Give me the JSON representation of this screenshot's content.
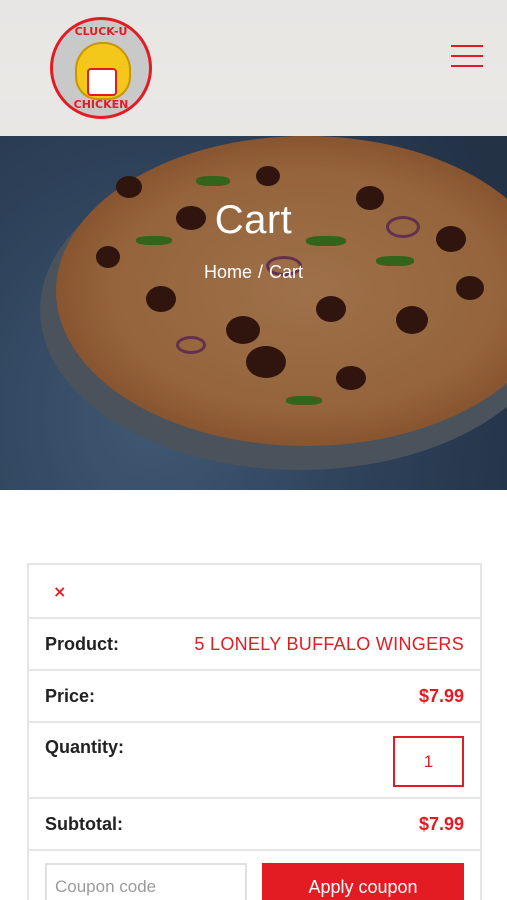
{
  "brand": {
    "logo_top_text": "CLUCK-U",
    "logo_bottom_text": "CHICKEN",
    "accent_color": "#e31b23"
  },
  "header": {
    "menu_icon": "hamburger-menu-icon"
  },
  "hero": {
    "title": "Cart",
    "breadcrumb": {
      "home": "Home",
      "separator": "/",
      "current": "Cart"
    }
  },
  "cart": {
    "remove_symbol": "×",
    "product_label": "Product:",
    "product_name": "5 LONELY BUFFALO WINGERS",
    "price_label": "Price:",
    "price_value": "$7.99",
    "quantity_label": "Quantity:",
    "quantity_value": "1",
    "subtotal_label": "Subtotal:",
    "subtotal_value": "$7.99",
    "coupon_placeholder": "Coupon code",
    "apply_coupon_label": "Apply coupon"
  }
}
